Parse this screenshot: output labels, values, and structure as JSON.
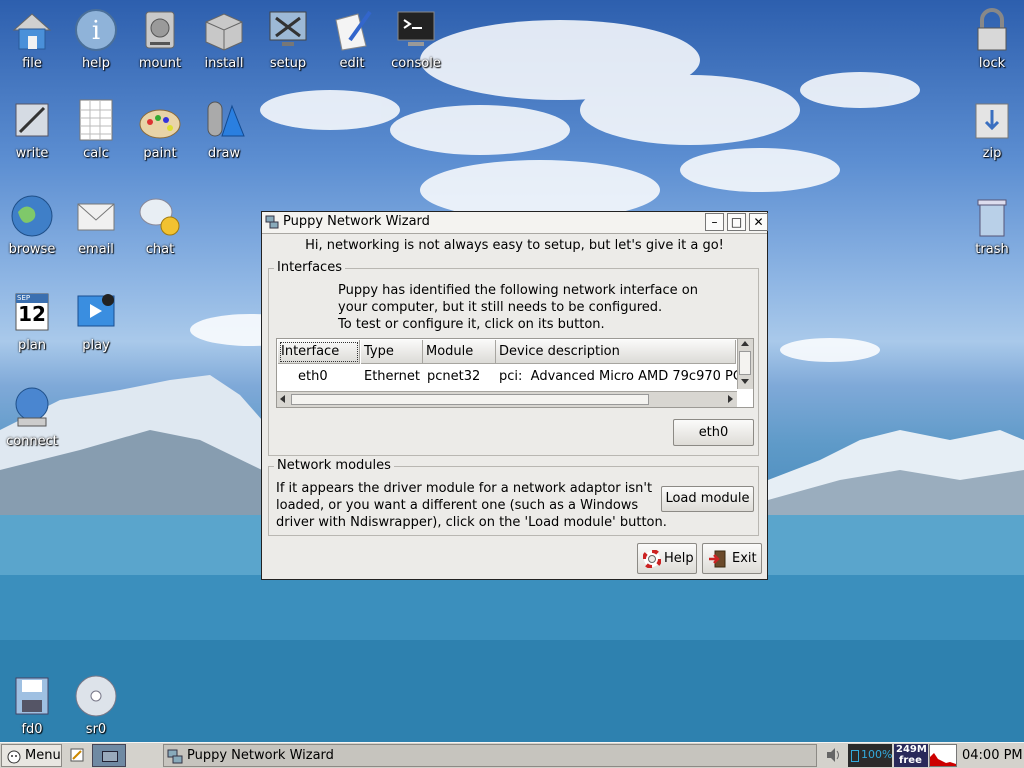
{
  "desktop": {
    "icons_left": [
      {
        "label": "file",
        "icon": "home-folder-icon"
      },
      {
        "label": "help",
        "icon": "info-icon"
      },
      {
        "label": "mount",
        "icon": "drive-icon"
      },
      {
        "label": "install",
        "icon": "package-box-icon"
      },
      {
        "label": "setup",
        "icon": "tools-monitor-icon"
      },
      {
        "label": "edit",
        "icon": "pen-paper-icon"
      },
      {
        "label": "console",
        "icon": "terminal-icon"
      },
      {
        "label": "write",
        "icon": "writer-icon"
      },
      {
        "label": "calc",
        "icon": "spreadsheet-icon"
      },
      {
        "label": "paint",
        "icon": "palette-icon"
      },
      {
        "label": "draw",
        "icon": "draw-shapes-icon"
      },
      {
        "label": "browse",
        "icon": "globe-icon"
      },
      {
        "label": "email",
        "icon": "envelope-icon"
      },
      {
        "label": "chat",
        "icon": "chat-bubble-icon"
      },
      {
        "label": "plan",
        "icon": "calendar-icon"
      },
      {
        "label": "play",
        "icon": "media-player-icon"
      },
      {
        "label": "connect",
        "icon": "network-globe-icon"
      }
    ],
    "calendar_icon": {
      "month": "SEP",
      "day": "12"
    },
    "icons_right": [
      {
        "label": "lock",
        "icon": "padlock-icon"
      },
      {
        "label": "zip",
        "icon": "archive-icon"
      },
      {
        "label": "trash",
        "icon": "trash-can-icon"
      }
    ],
    "icons_bottom": [
      {
        "label": "fd0",
        "icon": "floppy-icon"
      },
      {
        "label": "sr0",
        "icon": "cd-icon"
      }
    ]
  },
  "window": {
    "title": "Puppy Network Wizard",
    "minimize": "–",
    "maximize": "□",
    "close": "✕",
    "greeting": "Hi, networking is not always easy to setup, but let's give it a go!",
    "interfaces": {
      "title": "Interfaces",
      "description": [
        "Puppy has identified the following network interface on",
        "your computer, but it still needs to be configured.",
        "To test or configure it, click on its button."
      ],
      "columns": [
        "Interface",
        "Type",
        "Module",
        "Device description"
      ],
      "rows": [
        {
          "interface": "eth0",
          "type": "Ethernet",
          "module": "pcnet32",
          "description": "pci:  Advanced Micro AMD 79c970 PC"
        }
      ],
      "button": "eth0"
    },
    "modules": {
      "title": "Network modules",
      "description": [
        "If it appears the driver module for a network adaptor isn't",
        "loaded, or you want a different one (such as a Windows",
        "driver with Ndiswrapper), click on the 'Load module' button."
      ],
      "button": "Load module"
    },
    "help_button": "Help",
    "exit_button": "Exit"
  },
  "taskbar": {
    "menu_label": "Menu",
    "task_title": "Puppy Network Wizard",
    "battery": "100%",
    "memory_top": "249M",
    "memory_bottom": "free",
    "clock": "04:00 PM"
  }
}
